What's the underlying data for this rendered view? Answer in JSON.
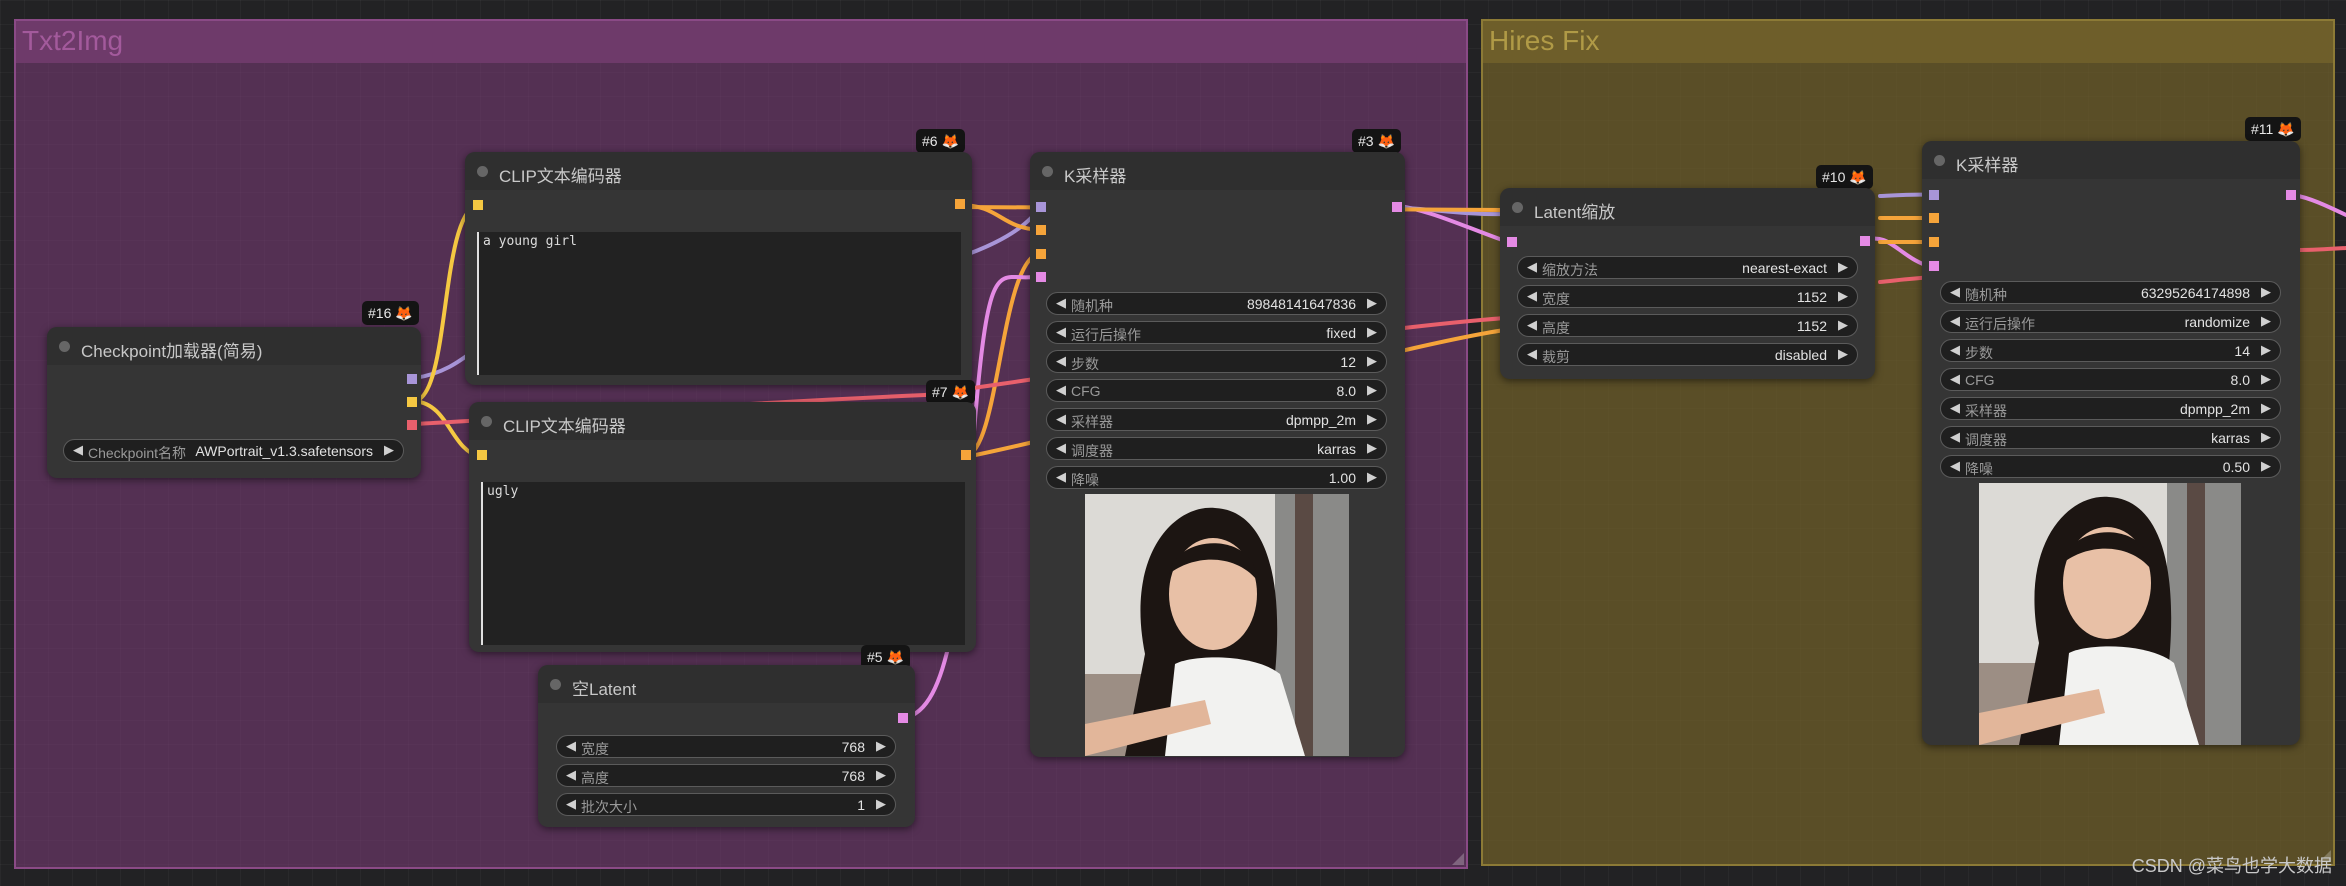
{
  "groups": {
    "txt2img": {
      "title": "Txt2Img"
    },
    "hires": {
      "title": "Hires Fix"
    }
  },
  "nodes": {
    "checkpoint": {
      "badge": "#16",
      "title": "Checkpoint加载器(简易)",
      "widgets": [
        {
          "label": "Checkpoint名称",
          "value": "AWPortrait_v1.3.safetensors"
        }
      ]
    },
    "clip_pos": {
      "badge": "#6",
      "title": "CLIP文本编码器",
      "text": "a young girl"
    },
    "clip_neg": {
      "badge": "#7",
      "title": "CLIP文本编码器",
      "text": "ugly"
    },
    "empty_latent": {
      "badge": "#5",
      "title": "空Latent",
      "widgets": [
        {
          "label": "宽度",
          "value": "768"
        },
        {
          "label": "高度",
          "value": "768"
        },
        {
          "label": "批次大小",
          "value": "1"
        }
      ]
    },
    "ksampler1": {
      "badge": "#3",
      "title": "K采样器",
      "widgets": [
        {
          "label": "随机种",
          "value": "89848141647836"
        },
        {
          "label": "运行后操作",
          "value": "fixed"
        },
        {
          "label": "步数",
          "value": "12"
        },
        {
          "label": "CFG",
          "value": "8.0"
        },
        {
          "label": "采样器",
          "value": "dpmpp_2m"
        },
        {
          "label": "调度器",
          "value": "karras"
        },
        {
          "label": "降噪",
          "value": "1.00"
        }
      ]
    },
    "latent_upscale": {
      "badge": "#10",
      "title": "Latent缩放",
      "widgets": [
        {
          "label": "缩放方法",
          "value": "nearest-exact"
        },
        {
          "label": "宽度",
          "value": "1152"
        },
        {
          "label": "高度",
          "value": "1152"
        },
        {
          "label": "裁剪",
          "value": "disabled"
        }
      ]
    },
    "ksampler2": {
      "badge": "#11",
      "title": "K采样器",
      "widgets": [
        {
          "label": "随机种",
          "value": "63295264174898"
        },
        {
          "label": "运行后操作",
          "value": "randomize"
        },
        {
          "label": "步数",
          "value": "14"
        },
        {
          "label": "CFG",
          "value": "8.0"
        },
        {
          "label": "采样器",
          "value": "dpmpp_2m"
        },
        {
          "label": "调度器",
          "value": "karras"
        },
        {
          "label": "降噪",
          "value": "0.50"
        }
      ]
    }
  },
  "icons": {
    "badge_icon": "fox-icon",
    "arrow_left": "triangle-left-icon",
    "arrow_right": "triangle-right-icon"
  },
  "colors": {
    "model": "#b39ddb",
    "clip": "#ffd54f",
    "vae": "#ef5f6f",
    "conditioning": "#ffa931",
    "latent": "#ff9cf9",
    "group_txt2img": "#7e3c7a",
    "group_hires": "#706028"
  },
  "watermark": "CSDN @菜鸟也学大数据"
}
